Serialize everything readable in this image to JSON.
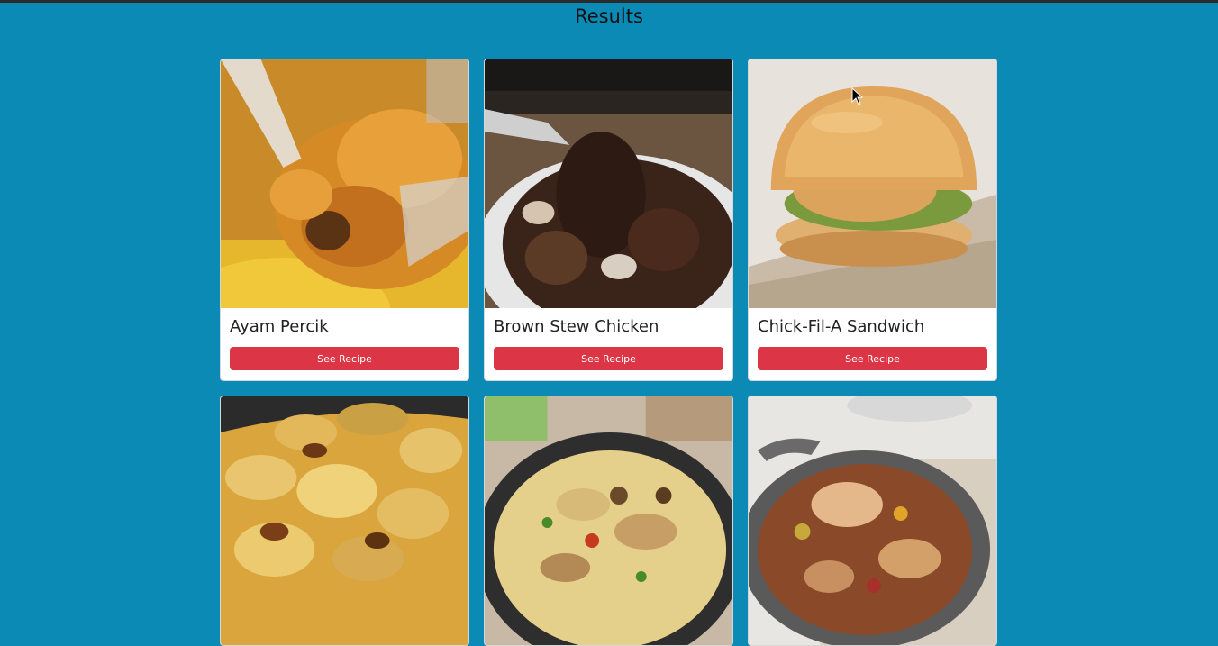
{
  "page": {
    "title": "Results"
  },
  "results": [
    {
      "name": "Ayam Percik",
      "button": "See Recipe",
      "image": "grilled-chicken-curry-photo"
    },
    {
      "name": "Brown Stew Chicken",
      "button": "See Recipe",
      "image": "brown-stew-photo"
    },
    {
      "name": "Chick-Fil-A Sandwich",
      "button": "See Recipe",
      "image": "chicken-sandwich-photo"
    },
    {
      "image": "potato-gratin-photo"
    },
    {
      "image": "pasta-skillet-photo"
    },
    {
      "image": "chicken-stew-pan-photo"
    }
  ],
  "colors": {
    "background": "#0a8ab5",
    "button": "#dc3545"
  }
}
